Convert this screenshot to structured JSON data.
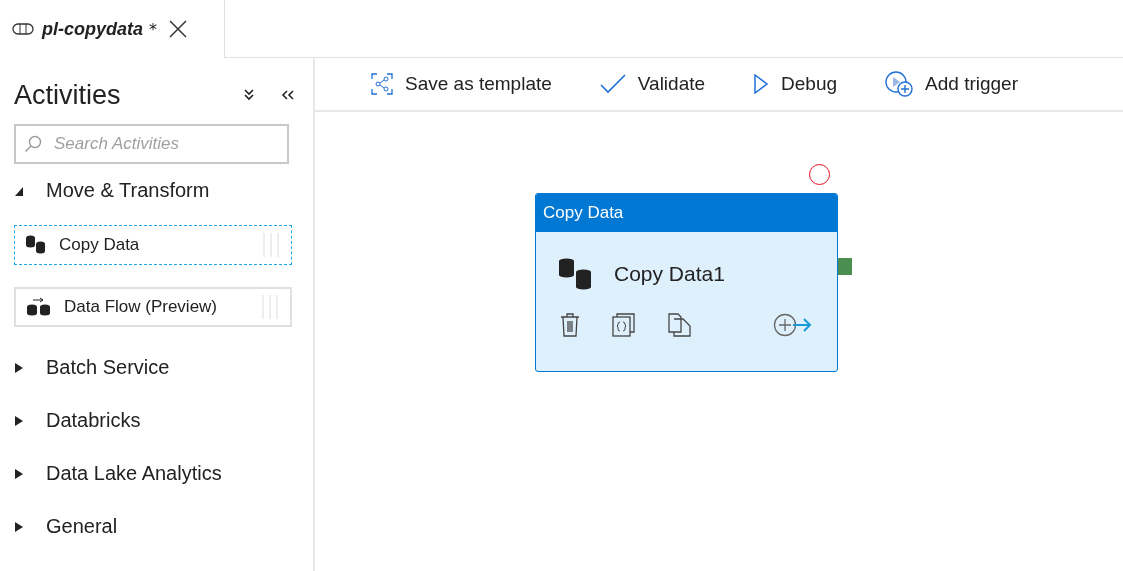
{
  "tab": {
    "title": "pl-copydata",
    "modified_mark": "*"
  },
  "sidebar": {
    "title": "Activities",
    "search": {
      "placeholder": "Search Activities"
    },
    "categories": [
      {
        "label": "Move & Transform",
        "expanded": true,
        "children": [
          {
            "label": "Copy Data",
            "kind": "copy",
            "selected": true
          },
          {
            "label": "Data Flow (Preview)",
            "kind": "dataflow",
            "selected": false
          }
        ]
      },
      {
        "label": "Batch Service",
        "expanded": false
      },
      {
        "label": "Databricks",
        "expanded": false
      },
      {
        "label": "Data Lake Analytics",
        "expanded": false
      },
      {
        "label": "General",
        "expanded": false
      }
    ]
  },
  "toolbar": [
    {
      "label": "Save as template",
      "kind": "template"
    },
    {
      "label": "Validate",
      "kind": "validate"
    },
    {
      "label": "Debug",
      "kind": "debug"
    },
    {
      "label": "Add trigger",
      "kind": "trigger"
    }
  ],
  "canvas": {
    "node": {
      "header": "Copy Data",
      "name": "Copy Data1"
    }
  }
}
